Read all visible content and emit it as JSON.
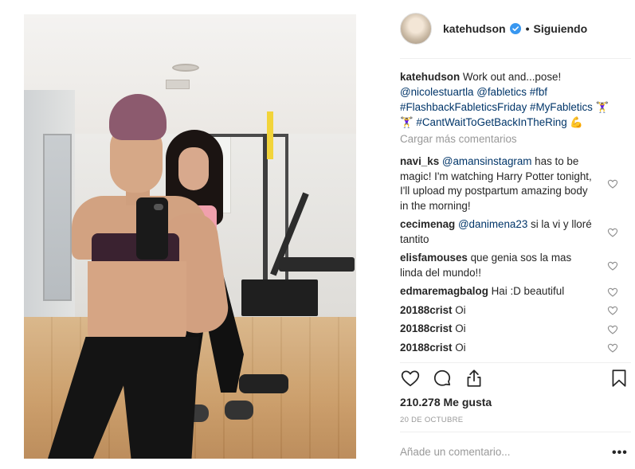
{
  "post": {
    "username": "katehudson",
    "follow_status": "Siguiendo",
    "separator": "•",
    "caption": {
      "username": "katehudson",
      "segments": [
        {
          "text": " Work out and...pose! ",
          "tag": false
        },
        {
          "text": "@nicolestuartla",
          "tag": true
        },
        {
          "text": " ",
          "tag": false
        },
        {
          "text": "@fabletics",
          "tag": true
        },
        {
          "text": " ",
          "tag": false
        },
        {
          "text": "#fbf",
          "tag": true
        },
        {
          "text": " ",
          "tag": false
        },
        {
          "text": "#FlashbackFableticsFriday",
          "tag": true
        },
        {
          "text": " ",
          "tag": false
        },
        {
          "text": "#MyFabletics",
          "tag": true
        },
        {
          "text": " 🏋️‍♀️🏋️‍♀️ ",
          "tag": false
        },
        {
          "text": "#CantWaitToGetBackInTheRing",
          "tag": true
        },
        {
          "text": " 💪",
          "tag": false
        }
      ]
    },
    "load_more": "Cargar más comentarios",
    "comments": [
      {
        "user": "navi_ks",
        "mention": "@amansinstagram",
        "text": " has to be magic! I'm watching Harry Potter tonight, I'll upload my postpartum amazing body in the morning!"
      },
      {
        "user": "cecimenag",
        "mention": "@danimena23",
        "text": " si la vi y lloré tantito"
      },
      {
        "user": "elisfamouses",
        "mention": "",
        "text": "que genia sos la mas linda del mundo!!"
      },
      {
        "user": "edmaremagbalog",
        "mention": "",
        "text": "Hai :D beautiful"
      },
      {
        "user": "20188crist",
        "mention": "",
        "text": "Oi"
      },
      {
        "user": "20188crist",
        "mention": "",
        "text": "Oi"
      },
      {
        "user": "20188crist",
        "mention": "",
        "text": "Oi"
      }
    ],
    "likes": "210.278 Me gusta",
    "date": "20 DE OCTUBRE",
    "add_comment_placeholder": "Añade un comentario...",
    "more_options": "•••",
    "icons": {
      "verified": "verified-badge-icon",
      "like": "heart-icon",
      "comment": "comment-bubble-icon",
      "share": "share-icon",
      "save": "bookmark-icon",
      "comment_like": "small-heart-icon"
    },
    "colors": {
      "text": "#262626",
      "link": "#003569",
      "muted": "#999999",
      "verified": "#3897f0",
      "divider": "#efefef"
    }
  }
}
